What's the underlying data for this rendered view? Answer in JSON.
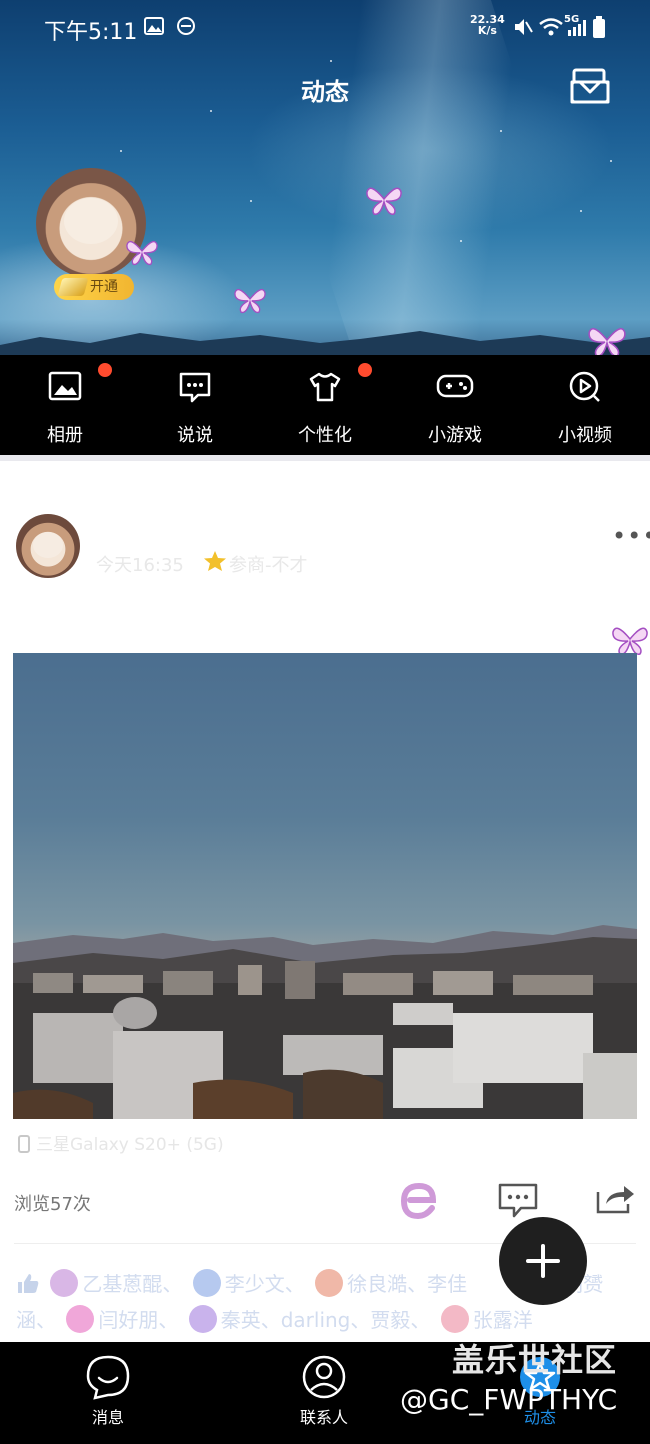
{
  "status_bar": {
    "time": "下午5:11",
    "net_speed_value": "22.34",
    "net_speed_unit": "K/s",
    "signal_label": "5G"
  },
  "header": {
    "title": "动态",
    "vip_badge_label": "开通"
  },
  "quick_menu": {
    "items": [
      {
        "label": "相册",
        "icon": "photo-album-icon",
        "has_dot": true
      },
      {
        "label": "说说",
        "icon": "speech-bubble-icon",
        "has_dot": false
      },
      {
        "label": "个性化",
        "icon": "tshirt-icon",
        "has_dot": true
      },
      {
        "label": "小游戏",
        "icon": "gamepad-icon",
        "has_dot": false
      },
      {
        "label": "小视频",
        "icon": "video-play-icon",
        "has_dot": false
      }
    ]
  },
  "post": {
    "time": "今天16:35",
    "status": "参商-不才",
    "device": "三星Galaxy S20+ (5G)",
    "views": "浏览57次",
    "likers_line1": [
      "乙基蒽醌、",
      "李少文、",
      "徐良澔、",
      "李佳",
      "胡赟"
    ],
    "likers_line2": [
      "涵、",
      "闫好朋、",
      "秦英、darling、贾毅、",
      "张露洋"
    ]
  },
  "bottom_nav": {
    "items": [
      {
        "label": "消息",
        "icon": "message-icon"
      },
      {
        "label": "联系人",
        "icon": "contacts-icon"
      },
      {
        "label": "动态",
        "icon": "star-feed-icon"
      }
    ]
  },
  "watermark": {
    "line1": "盖乐世社区",
    "line2": "@GC_FWPTHYC"
  },
  "colors": {
    "accent_dot": "#ff4b2e",
    "nav_bg": "#000000",
    "fab_bg": "#1f1f1f"
  }
}
